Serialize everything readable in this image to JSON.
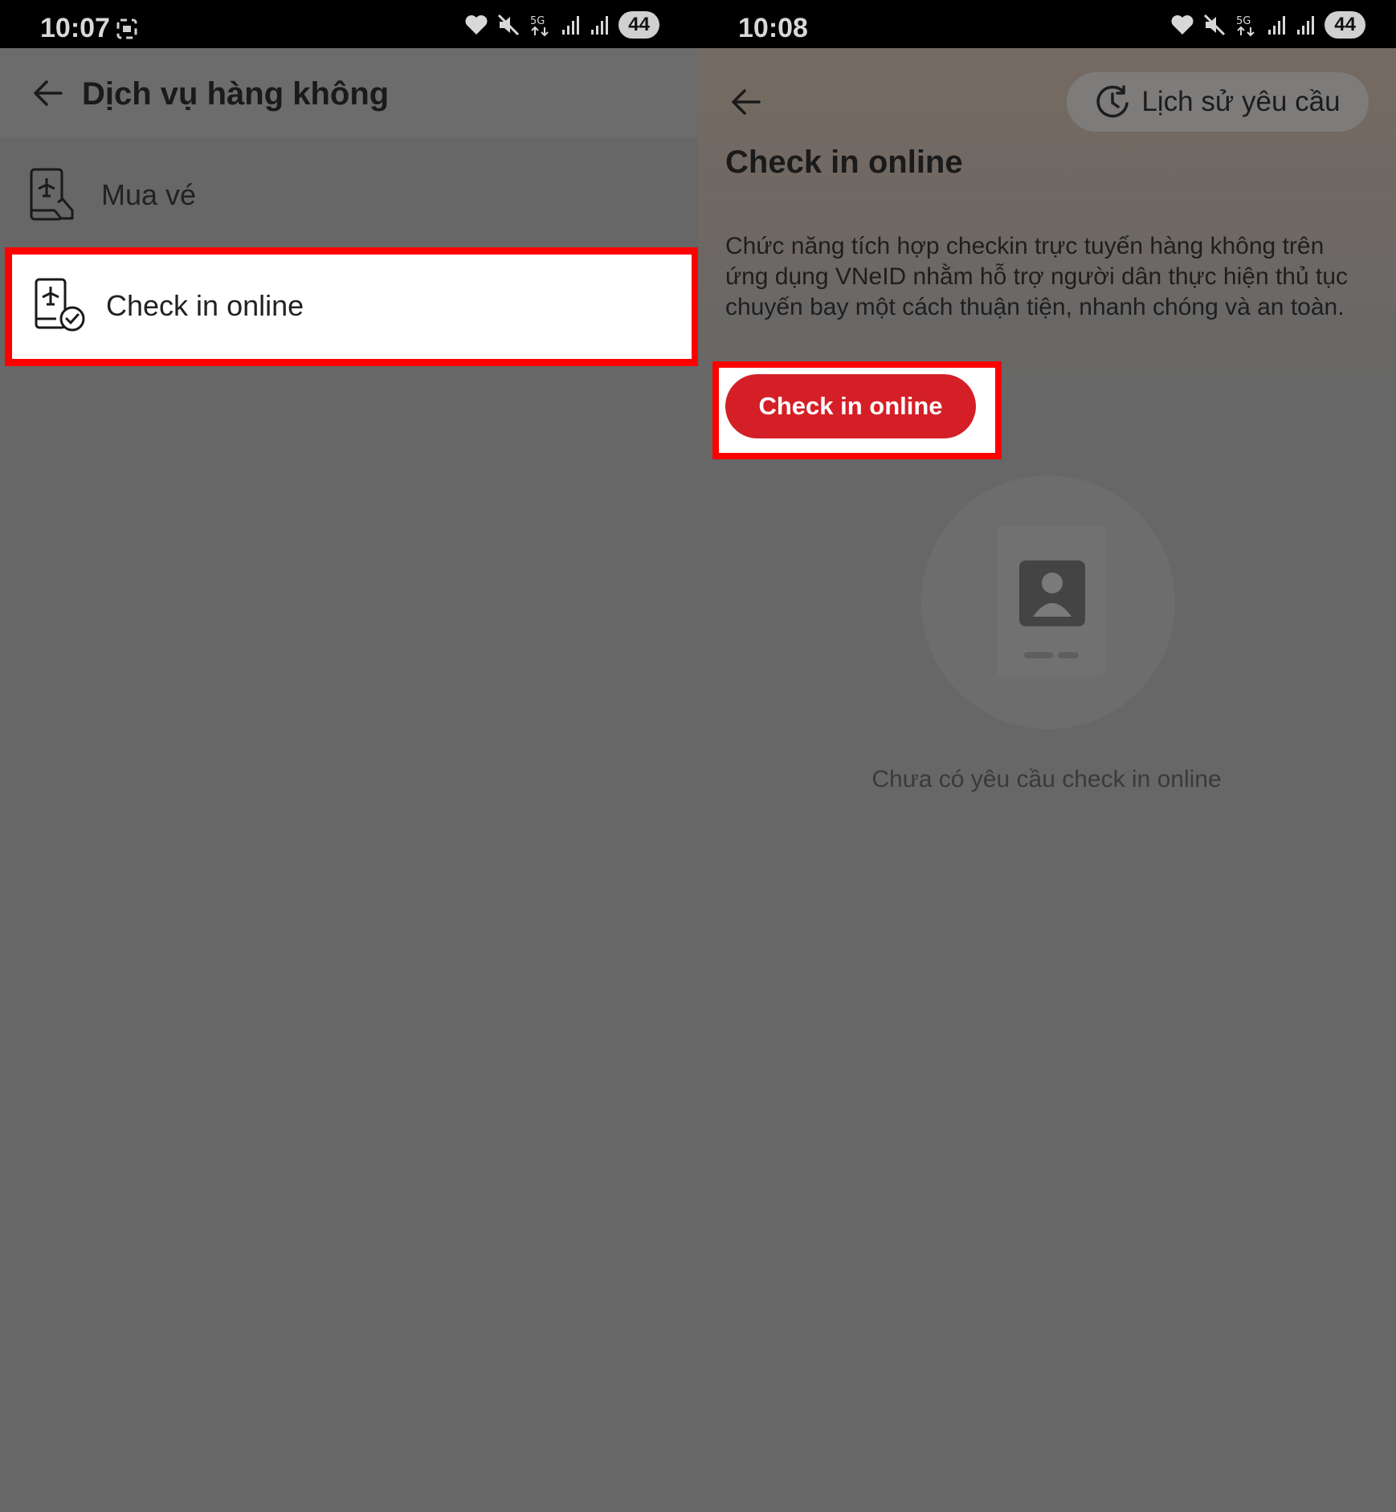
{
  "left_screen": {
    "status_bar": {
      "time": "10:07",
      "battery": "44"
    },
    "header": {
      "title": "Dịch vụ hàng không"
    },
    "menu_items": [
      {
        "label": "Mua vé",
        "icon": "plane-phone-hand-icon"
      },
      {
        "label": "Check in online",
        "icon": "plane-phone-check-icon"
      }
    ]
  },
  "right_screen": {
    "status_bar": {
      "time": "10:08",
      "battery": "44"
    },
    "history_button": {
      "label": "Lịch sử yêu cầu",
      "icon": "history-clock-icon"
    },
    "title": "Check in online",
    "description": "Chức năng tích hợp checkin trực tuyến hàng không trên ứng dụng VNeID nhằm hỗ trợ người dân thực hiện thủ tục chuyến bay một cách thuận tiện, nhanh chóng và an toàn.",
    "checkin_button": {
      "label": "Check in online"
    },
    "empty_state": {
      "text": "Chưa có yêu cầu check in online",
      "icon": "id-card-icon"
    }
  },
  "colors": {
    "overlay": "#676767",
    "accent": "#d51f27",
    "highlight": "#ff0000"
  }
}
